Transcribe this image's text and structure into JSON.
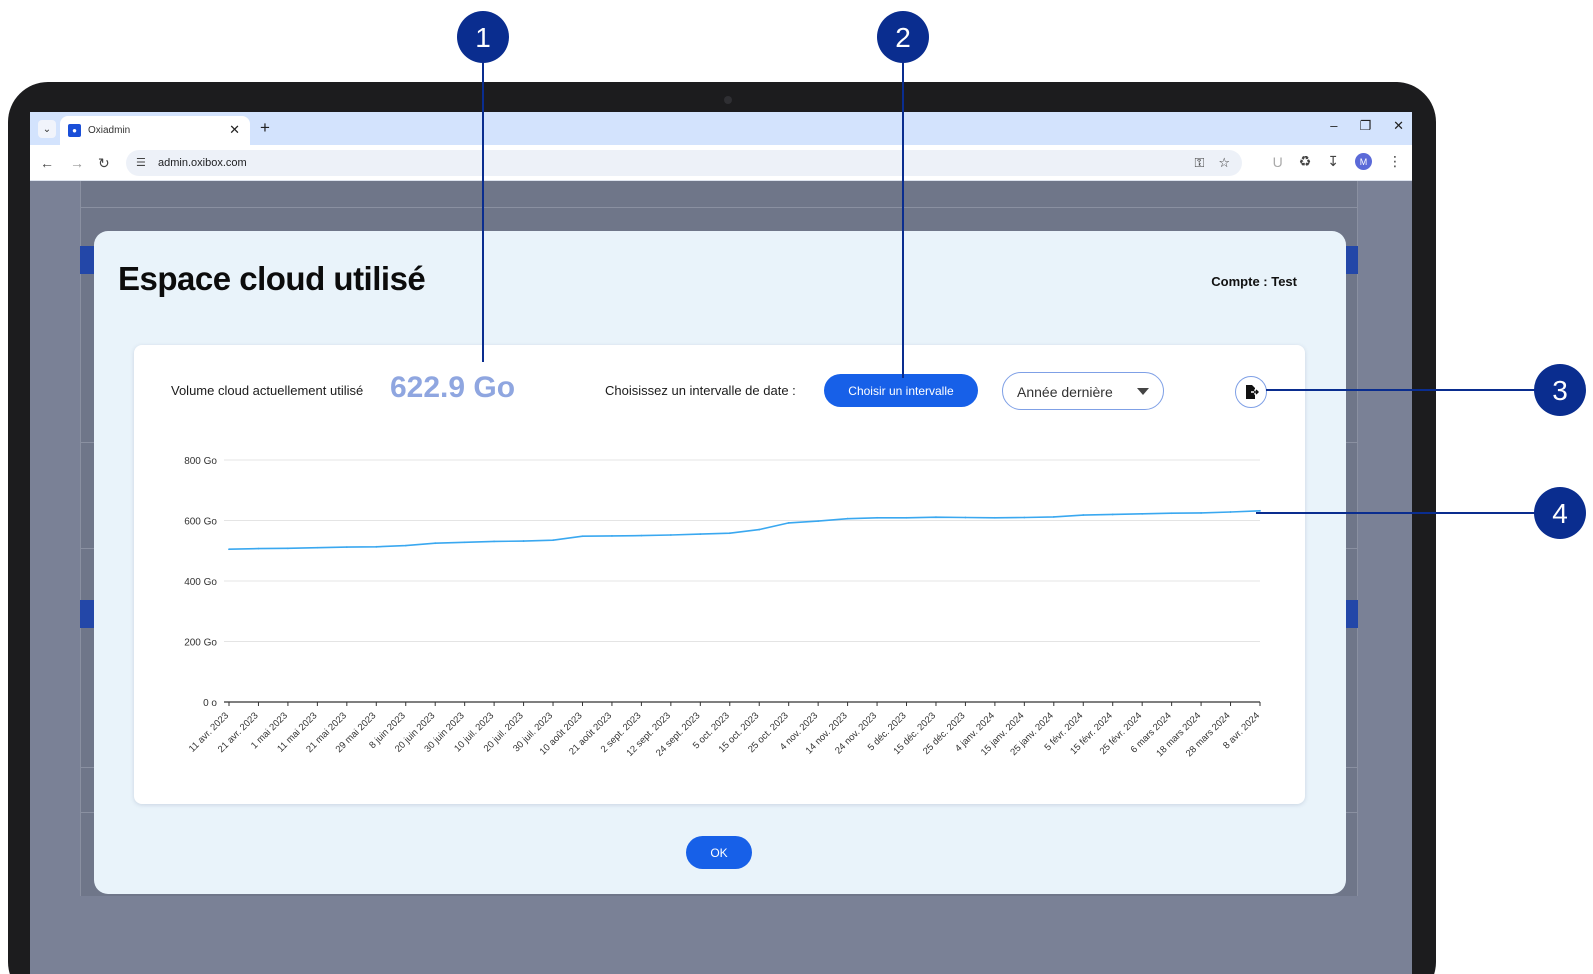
{
  "browser": {
    "tab_title": "Oxiadmin",
    "url": "admin.oxibox.com",
    "avatar_initial": "M"
  },
  "modal": {
    "title": "Espace cloud utilisé",
    "account": "Compte : Test",
    "volume_label": "Volume cloud actuellement utilisé",
    "volume_value": "622.9 Go",
    "date_label": "Choisissez un intervalle de date :",
    "interval_button": "Choisir un intervalle",
    "range_select_value": "Année dernière",
    "ok_button": "OK"
  },
  "callouts": [
    "1",
    "2",
    "3",
    "4"
  ],
  "colors": {
    "accent": "#1760e8",
    "callout": "#0a2d8f",
    "series": "#3aa8f0",
    "modal_bg": "#e9f3fa"
  },
  "chart_data": {
    "type": "line",
    "ylim": [
      0,
      800
    ],
    "ytick_labels": [
      "0 o",
      "200 Go",
      "400 Go",
      "600 Go",
      "800 Go"
    ],
    "yticks": [
      0,
      200,
      400,
      600,
      800
    ],
    "categories": [
      "11 avr. 2023",
      "21 avr. 2023",
      "1 mai 2023",
      "11 mai 2023",
      "21 mai 2023",
      "29 mai 2023",
      "8 juin 2023",
      "20 juin 2023",
      "30 juin 2023",
      "10 juil. 2023",
      "20 juil. 2023",
      "30 juil. 2023",
      "10 août 2023",
      "21 août 2023",
      "2 sept. 2023",
      "12 sept. 2023",
      "24 sept. 2023",
      "5 oct. 2023",
      "15 oct. 2023",
      "25 oct. 2023",
      "4 nov. 2023",
      "14 nov. 2023",
      "24 nov. 2023",
      "5 déc. 2023",
      "15 déc. 2023",
      "25 déc. 2023",
      "4 janv. 2024",
      "15 janv. 2024",
      "25 janv. 2024",
      "5 févr. 2024",
      "15 févr. 2024",
      "25 févr. 2024",
      "6 mars 2024",
      "18 mars 2024",
      "28 mars 2024",
      "8 avr. 2024"
    ],
    "series": [
      {
        "values": [
          505,
          507,
          508,
          510,
          512,
          513,
          517,
          525,
          528,
          531,
          532,
          535,
          548,
          549,
          550,
          552,
          555,
          558,
          570,
          592,
          598,
          606,
          609,
          609,
          611,
          610,
          609,
          610,
          612,
          618,
          620,
          622,
          624,
          625,
          628,
          632
        ]
      }
    ],
    "grid": true
  }
}
